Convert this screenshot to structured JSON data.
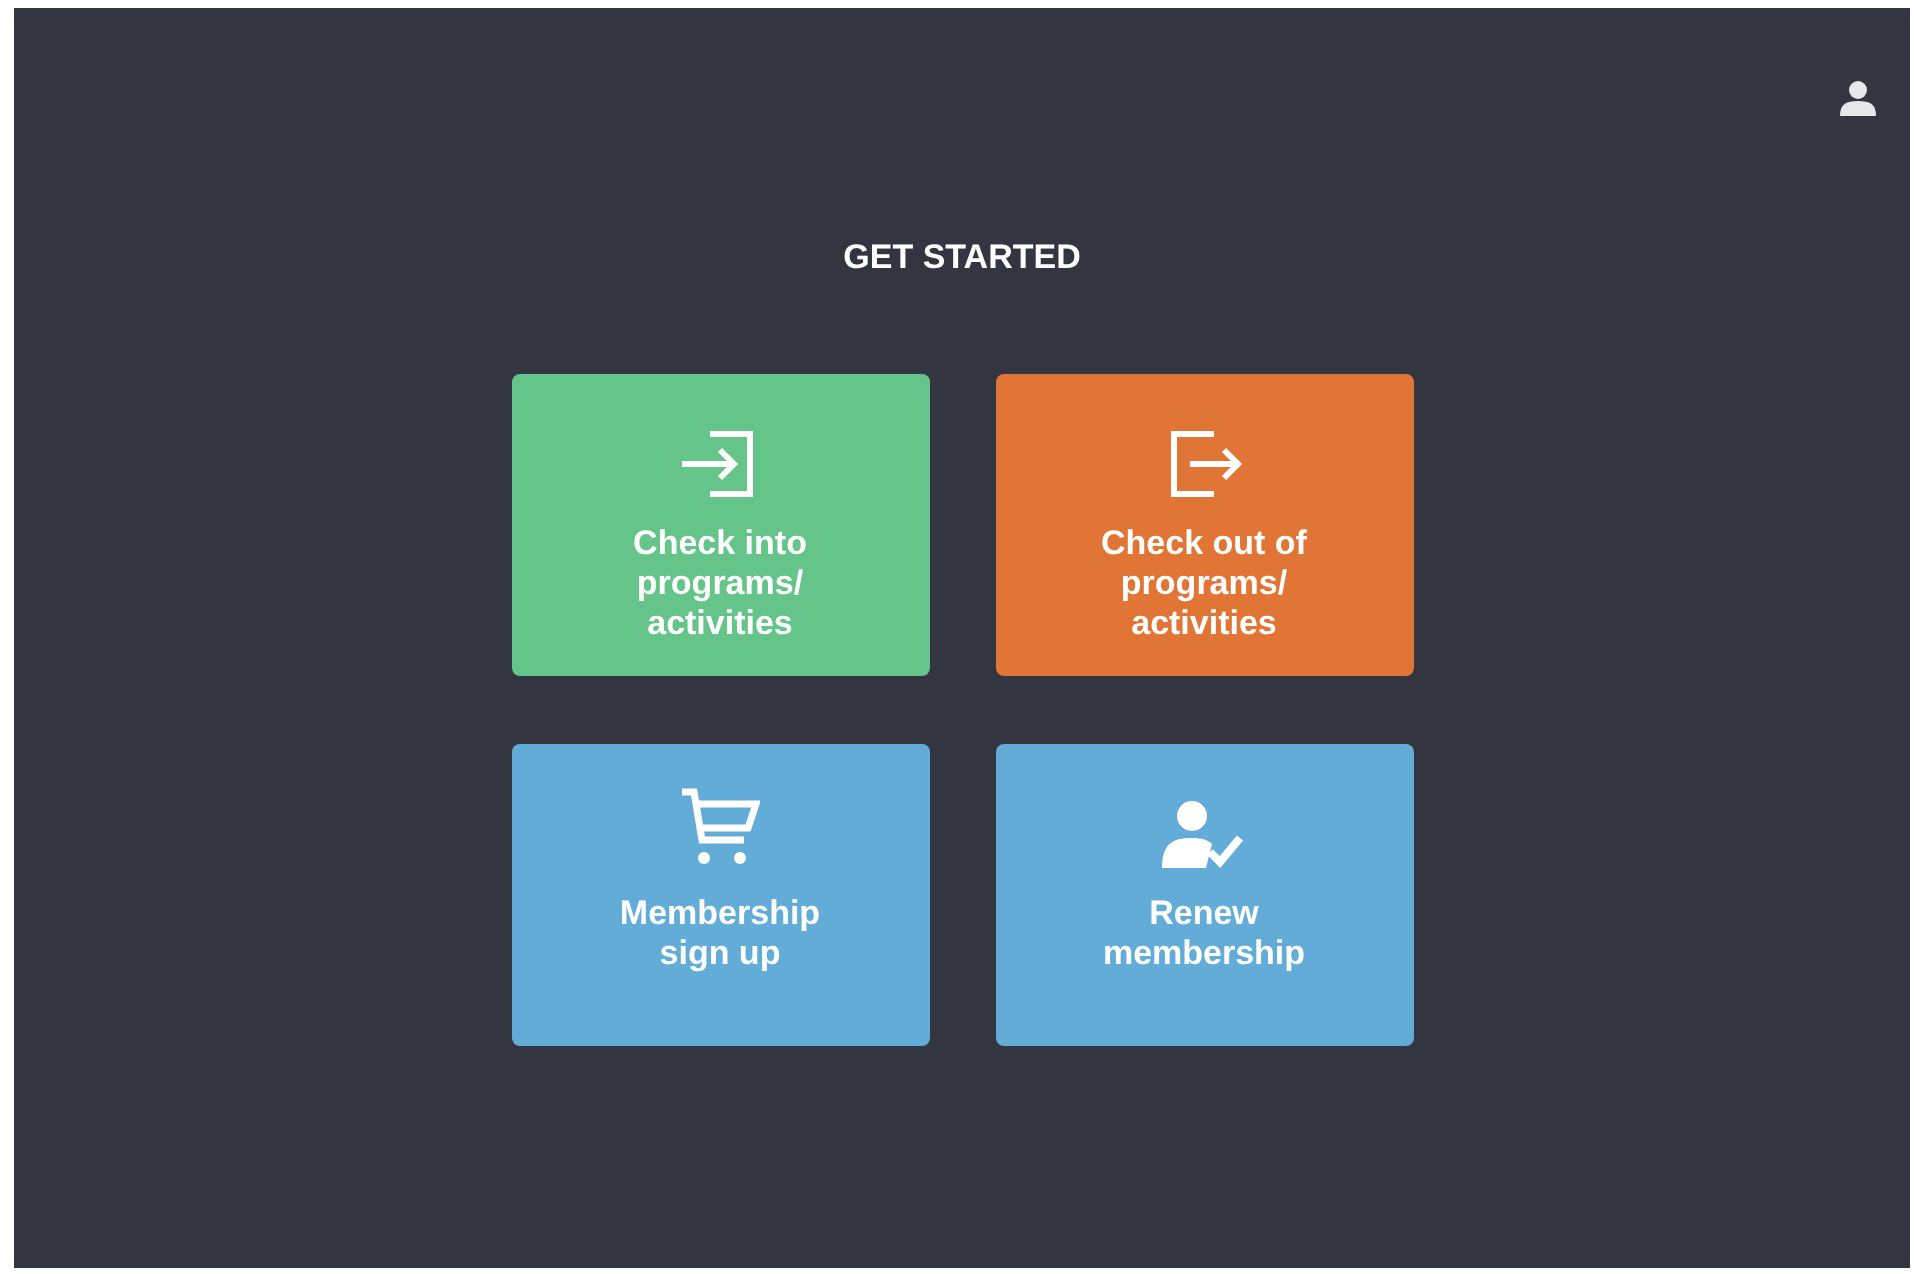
{
  "title": "GET STARTED",
  "tiles": [
    {
      "kind": "check-in",
      "label": "Check into programs/ activities",
      "color": "#64c48a"
    },
    {
      "kind": "check-out",
      "label": "Check out of programs/ activities",
      "color": "#e07535"
    },
    {
      "kind": "cart",
      "label": "Membership sign up",
      "color": "#62acd7"
    },
    {
      "kind": "renew",
      "label": "Renew membership",
      "color": "#62acd7"
    }
  ]
}
